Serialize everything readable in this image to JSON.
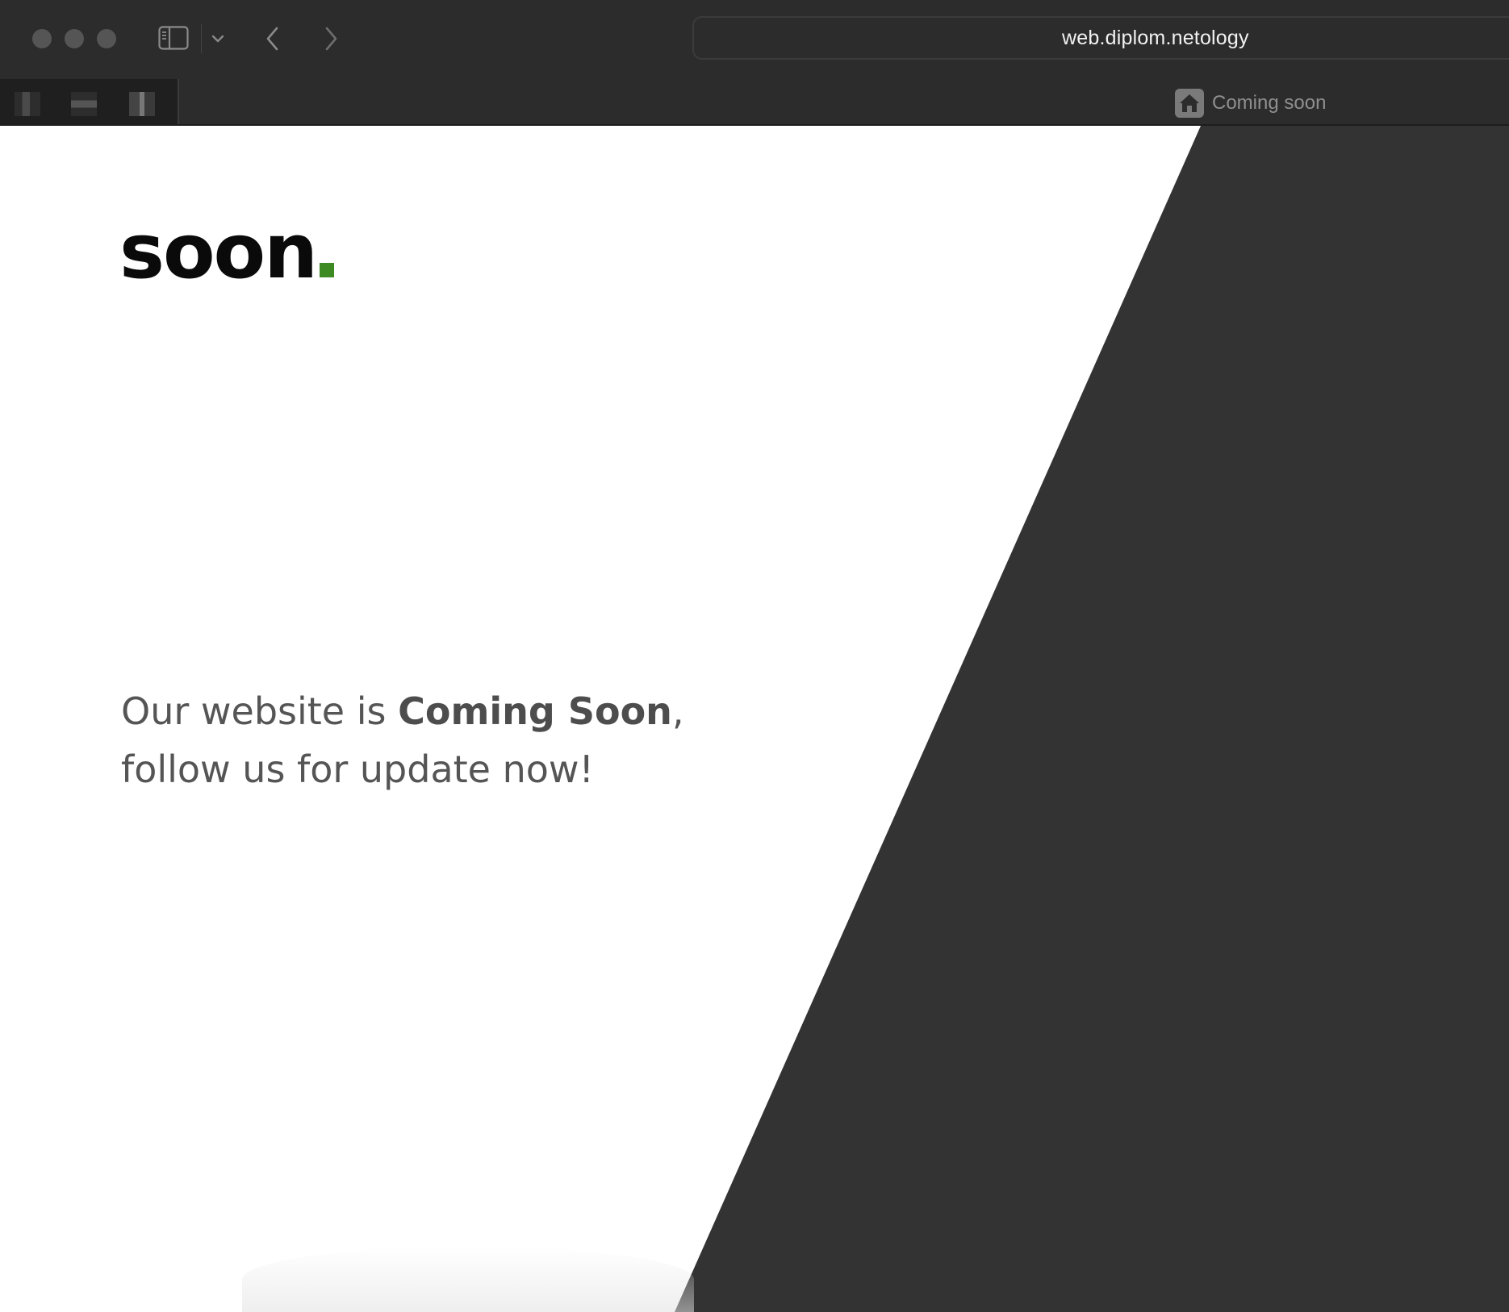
{
  "browser": {
    "url": "web.diplom.netology",
    "tab": {
      "title": "Coming soon",
      "icon": "home-icon"
    },
    "toolbar": {
      "sidebar_icon": "sidebar-icon",
      "chevron_icon": "chevron-down-icon",
      "back_icon": "chevron-left-icon",
      "forward_icon": "chevron-right-icon"
    }
  },
  "page": {
    "logo": {
      "text": "soon",
      "dot_color": "#3e8a22"
    },
    "tagline": {
      "prefix": "Our website is ",
      "emphasis": "Coming Soon",
      "suffix": ",",
      "line2": "follow us for update now!"
    },
    "colors": {
      "background_light": "#ffffff",
      "background_dark": "#333333",
      "text": "#555555"
    }
  }
}
